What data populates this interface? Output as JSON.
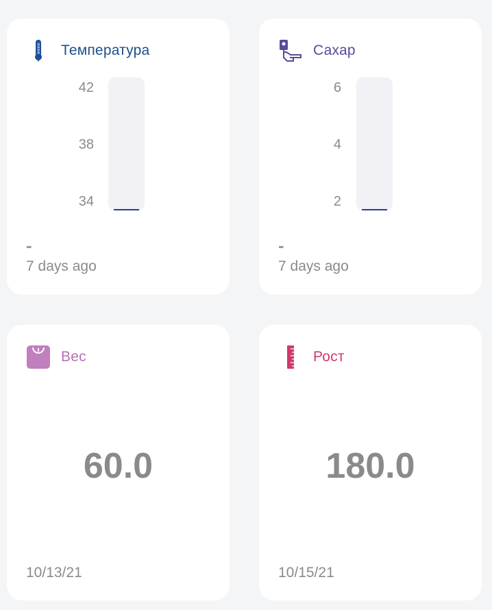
{
  "colors": {
    "temperature_title": "#1c4f8f",
    "sugar_title": "#5a4a9a",
    "weight_title": "#b870b0",
    "height_title": "#d03a6a",
    "bar_track": "#f1f1f6",
    "bar_fill": "#1f3f9a",
    "value_gray": "#8a8a8a"
  },
  "cards": {
    "temperature": {
      "icon": "thermometer-icon",
      "title": "Температура",
      "ticks": [
        "42",
        "38",
        "34"
      ],
      "value": "-",
      "time": "7 days ago"
    },
    "sugar": {
      "icon": "glucose-meter-icon",
      "title": "Сахар",
      "ticks": [
        "6",
        "4",
        "2"
      ],
      "value": "-",
      "time": "7 days ago"
    },
    "weight": {
      "icon": "scale-icon",
      "title": "Вес",
      "value": "60.0",
      "date": "10/13/21"
    },
    "height": {
      "icon": "ruler-icon",
      "title": "Рост",
      "value": "180.0",
      "date": "10/15/21"
    }
  }
}
